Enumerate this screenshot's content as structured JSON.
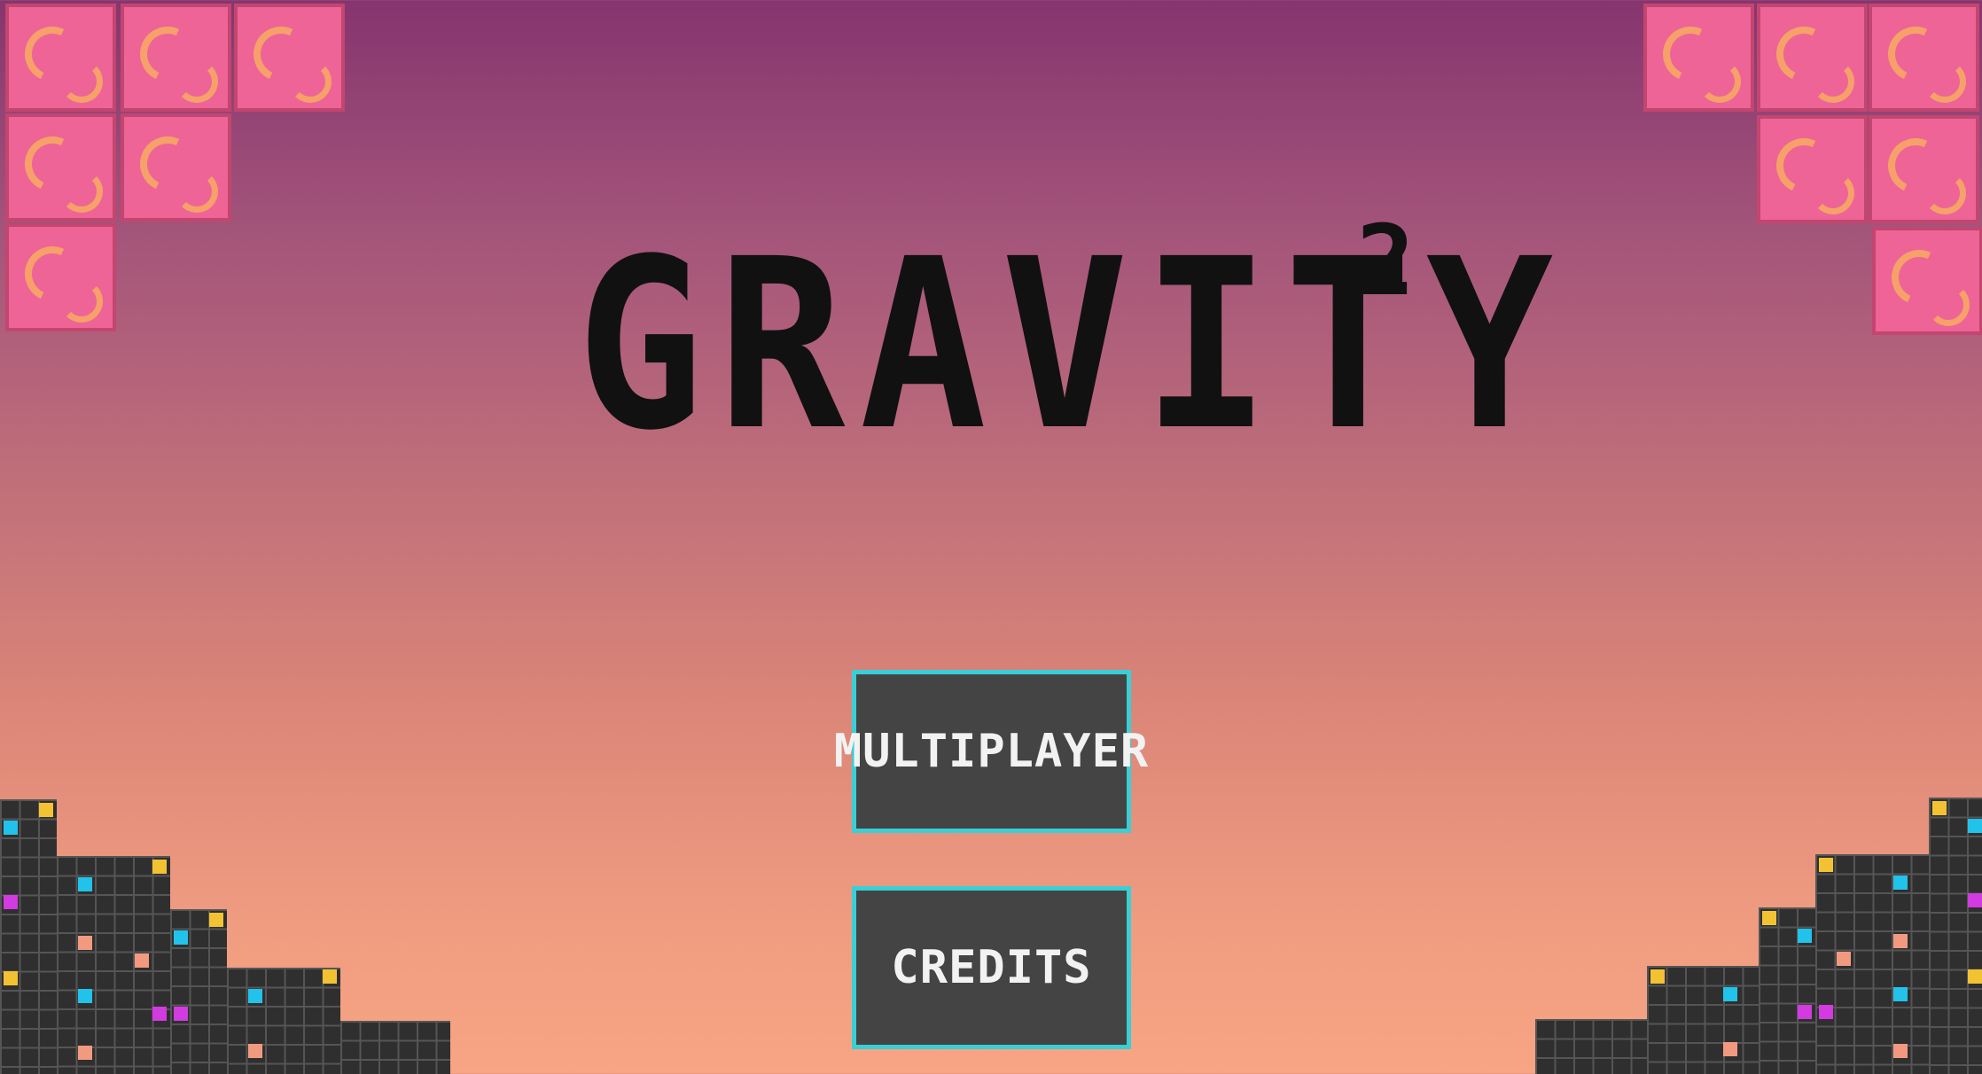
{
  "game": {
    "title": "GRAVITY",
    "title_superscript": "2"
  },
  "menu": {
    "buttons": [
      {
        "id": "multiplayer",
        "label": "MULTIPLAYER"
      },
      {
        "id": "credits",
        "label": "CREDITS"
      }
    ]
  },
  "colors": {
    "sky_top": "#86356f",
    "sky_bottom": "#f7a584",
    "block_pink": "#ee6496",
    "block_accent": "#f6a06a",
    "button_bg": "#444444",
    "button_border": "#39cfd6",
    "building": "#2f2f2f",
    "light_yellow": "#f3c233",
    "light_cyan": "#22c3ea",
    "light_magenta": "#d13be0",
    "light_salmon": "#f29a80"
  },
  "decor": {
    "corner_blocks": "pink-brain-tile-icon",
    "buildings": "pixel-building-icon"
  }
}
